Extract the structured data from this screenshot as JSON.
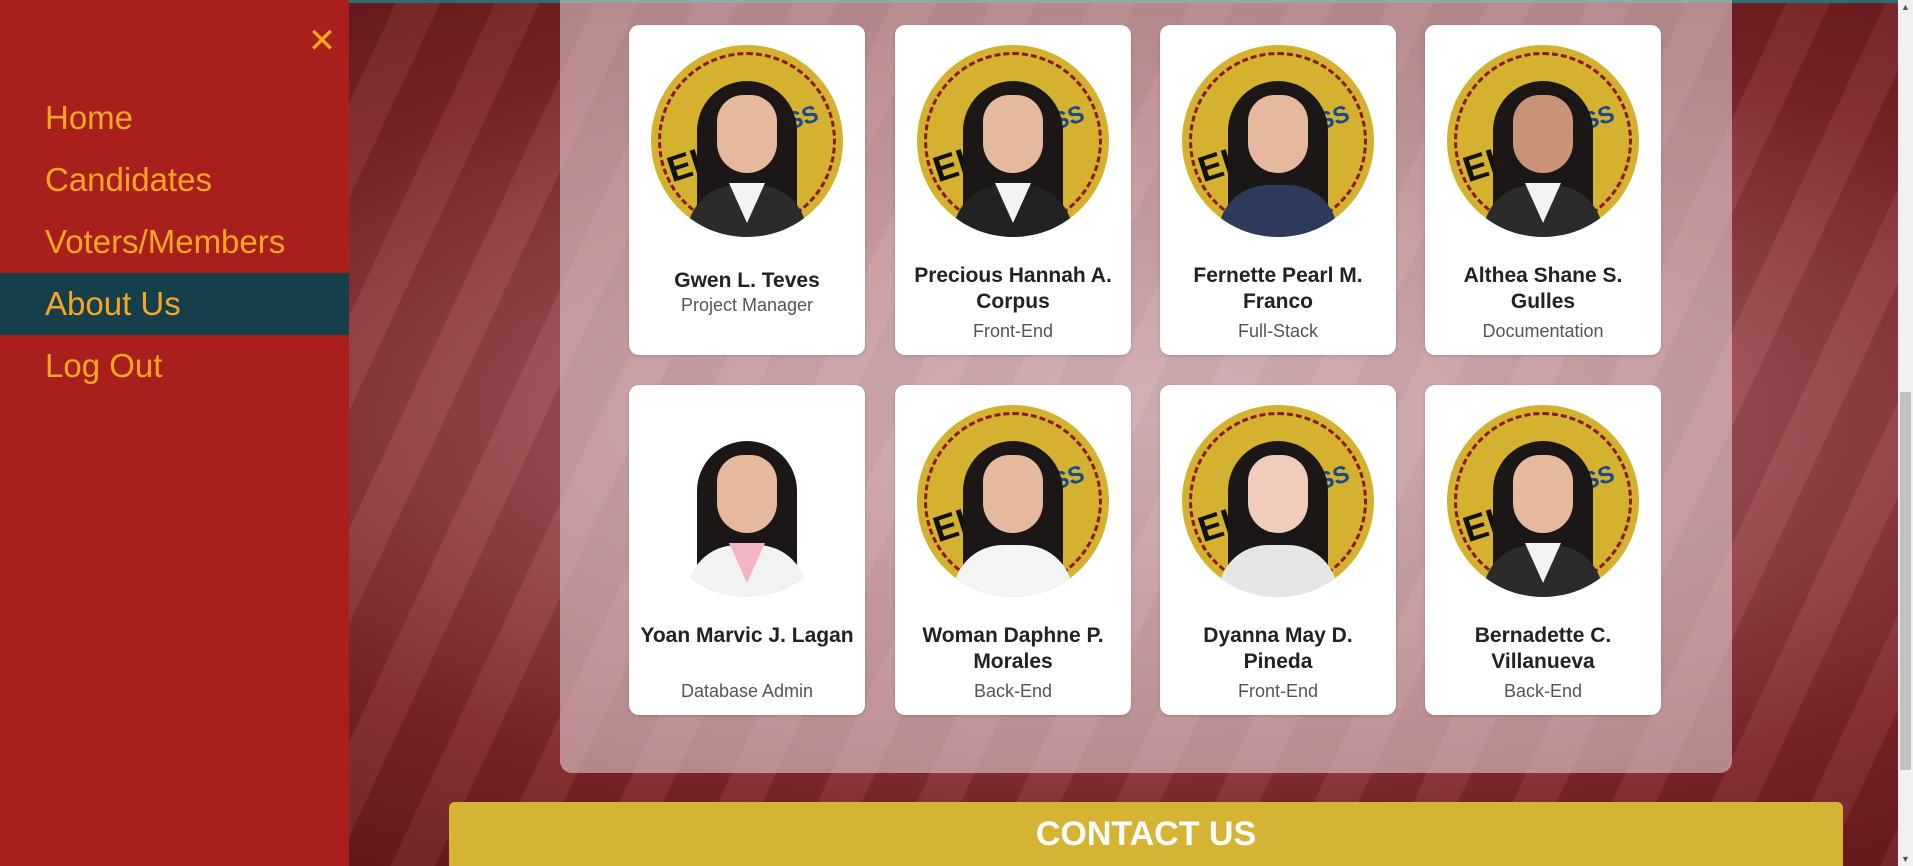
{
  "sidebar": {
    "close_icon": "close-icon",
    "items": [
      {
        "label": "Home",
        "active": false
      },
      {
        "label": "Candidates",
        "active": false
      },
      {
        "label": "Voters/Members",
        "active": false
      },
      {
        "label": "About Us",
        "active": true
      },
      {
        "label": "Log Out",
        "active": false
      }
    ]
  },
  "team": [
    {
      "name": "Gwen L. Teves",
      "role": "Project Manager"
    },
    {
      "name": "Precious Hannah A. Corpus",
      "role": "Front-End"
    },
    {
      "name": "Fernette Pearl M. Franco",
      "role": "Full-Stack"
    },
    {
      "name": "Althea Shane S. Gulles",
      "role": "Documentation"
    },
    {
      "name": "Yoan Marvic J. Lagan",
      "role": "Database Admin"
    },
    {
      "name": "Woman Daphne P. Morales",
      "role": "Back-End"
    },
    {
      "name": "Dyanna May D. Pineda",
      "role": "Front-End"
    },
    {
      "name": "Bernadette C. Villanueva",
      "role": "Back-End"
    }
  ],
  "logo": {
    "left": "EL-",
    "right": "ESS"
  },
  "contact": {
    "label": "CONTACT US"
  },
  "colors": {
    "sidebar": "#a91f1c",
    "active": "#143f4b",
    "accent": "#f5a623",
    "gold": "#d6b433"
  }
}
